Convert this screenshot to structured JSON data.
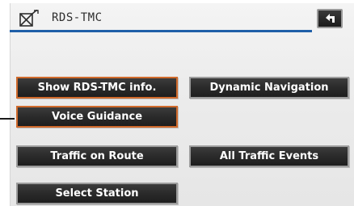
{
  "header": {
    "title": "RDS-TMC",
    "title_icon": "satellite-dish-crossed-icon",
    "back_icon": "return-arrow-icon"
  },
  "buttons": {
    "show_rds_tmc_info": "Show RDS-TMC info.",
    "dynamic_navigation": "Dynamic Navigation",
    "voice_guidance": "Voice Guidance",
    "traffic_on_route": "Traffic on Route",
    "all_traffic_events": "All Traffic Events",
    "select_station": "Select Station"
  },
  "colors": {
    "accent_line": "#1f5fa8",
    "selected_border": "#d06a2c",
    "button_bg": "#2a2a2a",
    "button_text": "#ffffff"
  }
}
